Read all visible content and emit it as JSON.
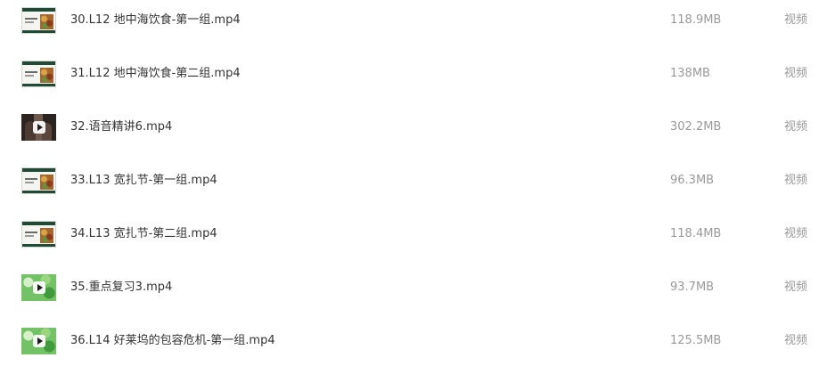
{
  "files": [
    {
      "name": "30.L12 地中海饮食-第一组.mp4",
      "size": "118.9MB",
      "type": "视频",
      "thumbnail_icon": "slide-thumbnail"
    },
    {
      "name": "31.L12 地中海饮食-第二组.mp4",
      "size": "138MB",
      "type": "视频",
      "thumbnail_icon": "slide-thumbnail"
    },
    {
      "name": "32.语音精讲6.mp4",
      "size": "302.2MB",
      "type": "视频",
      "thumbnail_icon": "video-thumbnail"
    },
    {
      "name": "33.L13 宽扎节-第一组.mp4",
      "size": "96.3MB",
      "type": "视频",
      "thumbnail_icon": "slide-thumbnail"
    },
    {
      "name": "34.L13 宽扎节-第二组.mp4",
      "size": "118.4MB",
      "type": "视频",
      "thumbnail_icon": "slide-thumbnail"
    },
    {
      "name": "35.重点复习3.mp4",
      "size": "93.7MB",
      "type": "视频",
      "thumbnail_icon": "video-thumbnail"
    },
    {
      "name": "36.L14 好莱坞的包容危机-第一组.mp4",
      "size": "125.5MB",
      "type": "视频",
      "thumbnail_icon": "video-thumbnail"
    }
  ],
  "colors": {
    "name_text": "#333333",
    "meta_text": "#999999",
    "slide_header": "#1f4a36",
    "review_green": "#74c266"
  }
}
